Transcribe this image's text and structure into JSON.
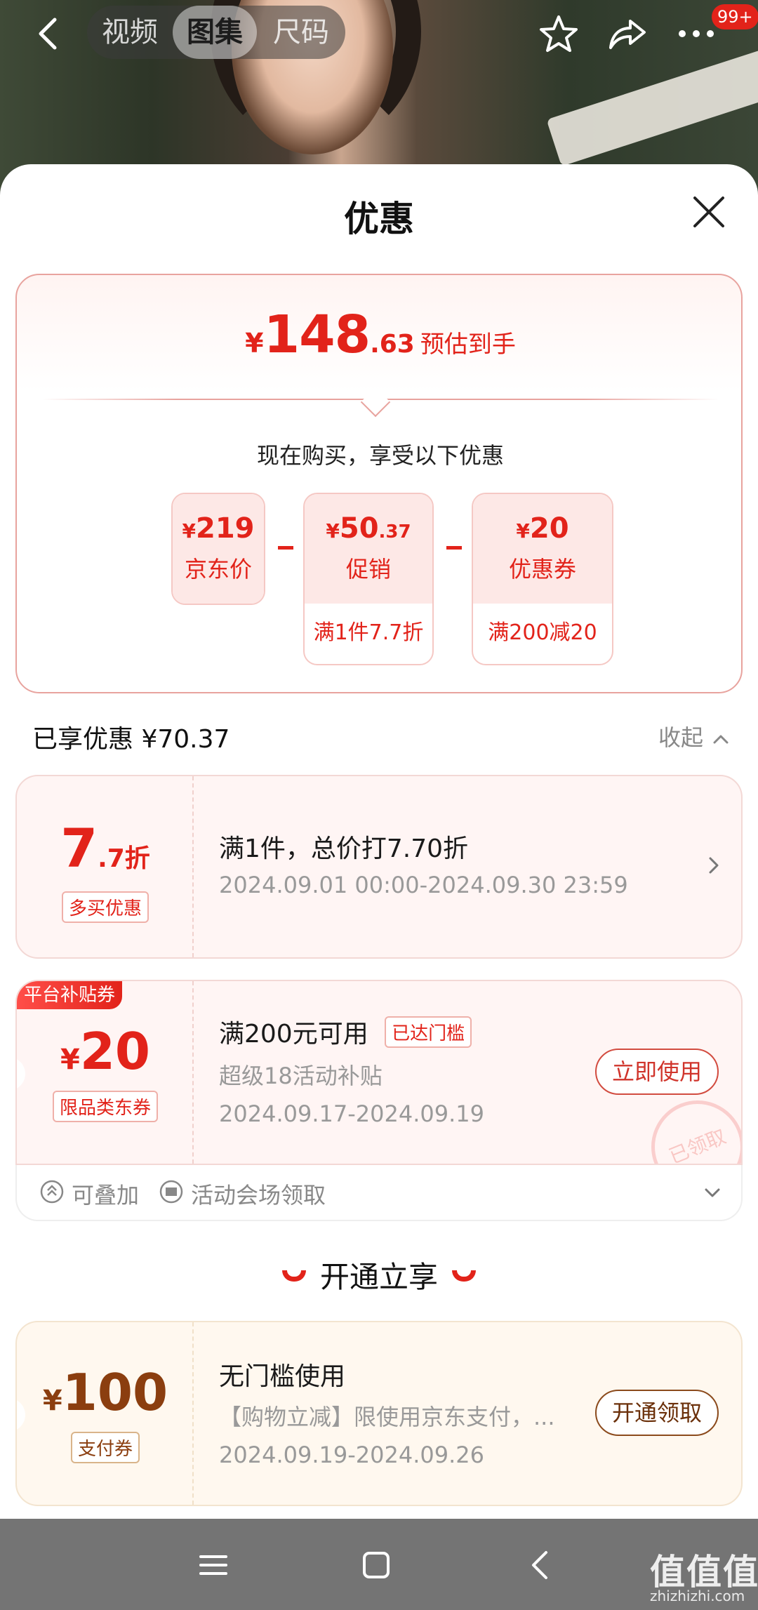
{
  "header": {
    "tabs": [
      {
        "label": "视频",
        "active": false
      },
      {
        "label": "图集",
        "active": true
      },
      {
        "label": "尺码",
        "active": false
      }
    ],
    "notification_badge": "99+",
    "icons": [
      "back-icon",
      "star-icon",
      "share-icon",
      "more-icon"
    ]
  },
  "sheet": {
    "title": "优惠",
    "summary": {
      "currency": "¥",
      "price_int": "148",
      "price_dec": ".63",
      "price_label": "预估到手",
      "intro": "现在购买，享受以下优惠",
      "breakdown": [
        {
          "currency": "¥",
          "amount": "219",
          "amount_dec": "",
          "name": "京东价",
          "condition": ""
        },
        {
          "currency": "¥",
          "amount": "50",
          "amount_dec": ".37",
          "name": "促销",
          "condition": "满1件7.7折"
        },
        {
          "currency": "¥",
          "amount": "20",
          "amount_dec": "",
          "name": "优惠券",
          "condition": "满200减20"
        }
      ]
    },
    "enjoyed": {
      "label": "已享优惠 ¥70.37",
      "collapse_label": "收起"
    },
    "promo_card": {
      "discount_main": "7",
      "discount_rest": ".7折",
      "tag": "多买优惠",
      "title": "满1件，总价打7.70折",
      "period": "2024.09.01 00:00-2024.09.30 23:59"
    },
    "coupon_card": {
      "ribbon": "平台补贴券",
      "currency": "¥",
      "amount": "20",
      "tag": "限品类东券",
      "title": "满200元可用",
      "reached": "已达门槛",
      "source": "超级18活动补贴",
      "period": "2024.09.17-2024.09.19",
      "button": "立即使用",
      "stamp": "已领取",
      "stackable": "可叠加",
      "channel": "活动会场领取"
    },
    "open_section": {
      "title": "开通立享"
    },
    "pay_card": {
      "currency": "¥",
      "amount": "100",
      "tag": "支付券",
      "title": "无门槛使用",
      "desc": "【购物立减】限使用京东支付，...",
      "period": "2024.09.19-2024.09.26",
      "button": "开通领取"
    }
  },
  "watermark": {
    "title": "值值值",
    "domain": "zhizhizhi.com"
  },
  "colors": {
    "accent_red": "#e2231a",
    "gold_text": "#8b3e0f",
    "sysbar": "#747474"
  }
}
